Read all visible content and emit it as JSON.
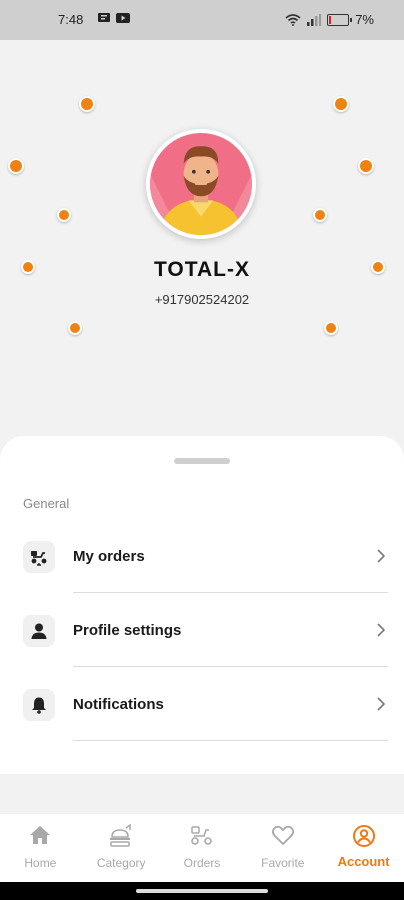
{
  "status_bar": {
    "time": "7:48",
    "battery": "7%",
    "icons": [
      "msg-icon",
      "youtube-icon",
      "wifi-icon",
      "signal-icon",
      "battery-icon"
    ]
  },
  "profile": {
    "name": "TOTAL-X",
    "phone": "+917902524202"
  },
  "general": {
    "label": "General",
    "items": [
      {
        "label": "My orders",
        "icon": "delivery-scooter-icon"
      },
      {
        "label": "Profile settings",
        "icon": "person-icon"
      },
      {
        "label": "Notifications",
        "icon": "bell-icon"
      }
    ]
  },
  "bottom_nav": {
    "items": [
      {
        "label": "Home",
        "icon": "home-icon"
      },
      {
        "label": "Category",
        "icon": "category-icon"
      },
      {
        "label": "Orders",
        "icon": "orders-icon"
      },
      {
        "label": "Favorite",
        "icon": "heart-icon"
      },
      {
        "label": "Account",
        "icon": "account-icon",
        "active": true
      }
    ]
  },
  "colors": {
    "accent": "#ee7a10",
    "dot": "#f08212",
    "inactive": "#a9a9a9"
  }
}
